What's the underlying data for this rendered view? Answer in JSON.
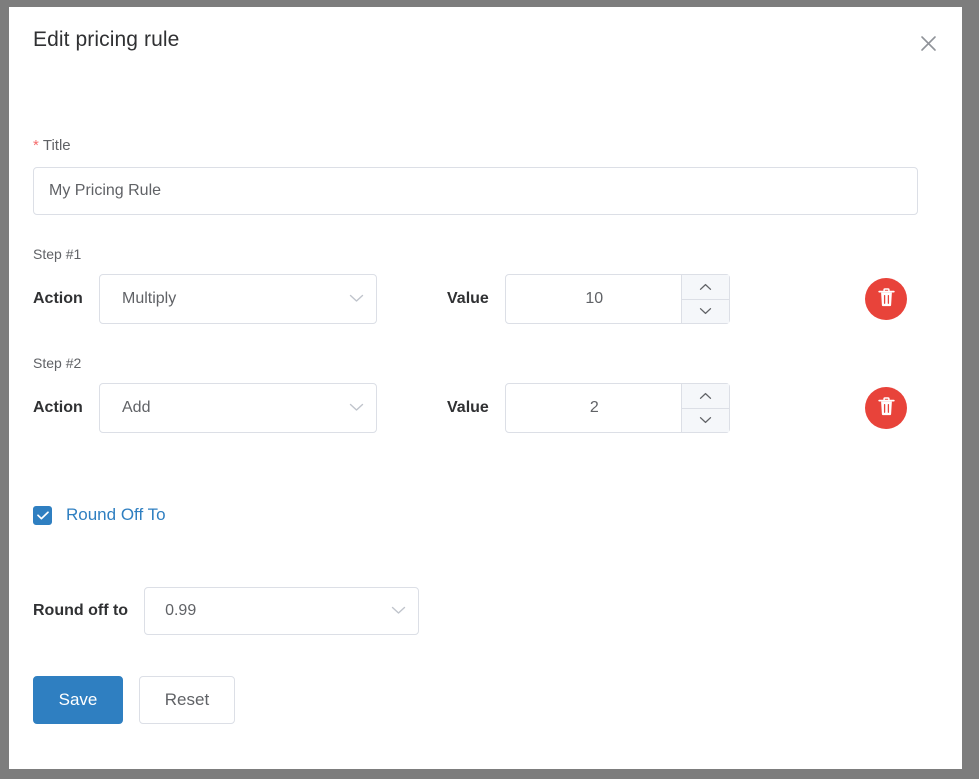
{
  "dialog": {
    "title": "Edit pricing rule",
    "close_icon": "close-icon"
  },
  "title_field": {
    "required_marker": "*",
    "label": "Title",
    "value": "My Pricing Rule",
    "placeholder": "Title"
  },
  "steps": [
    {
      "caption": "Step #1",
      "action_label": "Action",
      "action_value": "Multiply",
      "value_label": "Value",
      "value": "10",
      "delete_icon": "trash-icon"
    },
    {
      "caption": "Step #2",
      "action_label": "Action",
      "action_value": "Add",
      "value_label": "Value",
      "value": "2",
      "delete_icon": "trash-icon"
    }
  ],
  "round_off": {
    "checkbox_label": "Round Off To",
    "checked": true,
    "select_label": "Round off to",
    "select_value": "0.99"
  },
  "footer": {
    "save_label": "Save",
    "reset_label": "Reset"
  },
  "colors": {
    "accent": "#2f7fc1",
    "danger": "#e8433a",
    "required": "#f56c6c",
    "border": "#dcdfe6",
    "backdrop": "#7d7d7d"
  }
}
